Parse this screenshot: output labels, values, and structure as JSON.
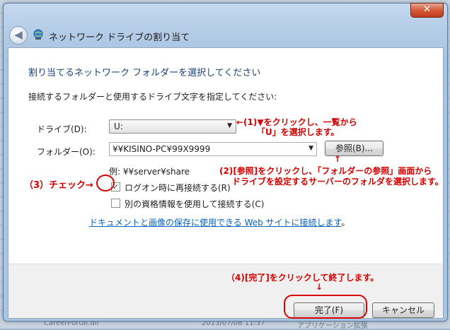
{
  "window": {
    "title": "ネットワーク ドライブの割り当て",
    "close_glyph": "✕"
  },
  "background_strip": {
    "items": [
      "CareerPortal.dll",
      "2013/07/08 11:37",
      "アプリケーション拡張"
    ]
  },
  "content": {
    "heading": "割り当てるネットワーク フォルダーを選択してください",
    "subtext": "接続するフォルダーと使用するドライブ文字を指定してください:",
    "drive_label": "ドライブ(D):",
    "drive_value": "U:",
    "folder_label": "フォルダー(O):",
    "folder_value": "¥¥KISINO-PC¥99X9999",
    "browse_label": "参照(B)...",
    "example": "例: ¥¥server¥share",
    "reconnect_label": "ログオン時に再接続する(R)",
    "reconnect_checked": true,
    "credentials_label": "別の資格情報を使用して接続する(C)",
    "credentials_checked": false,
    "link_text": "ドキュメントと画像の保存に使用できる Web サイトに接続します",
    "link_suffix": "。"
  },
  "footer": {
    "finish_label": "完了(F)",
    "cancel_label": "キャンセル"
  },
  "annotations": {
    "drive_note_line1": "←(1)▼をクリックし、一覧から",
    "drive_note_line2": "「U」を選択します。",
    "browse_note_arrow": "↑",
    "browse_note_line1": "(2)[参照]をクリックし、「フォルダーの参照」画面から",
    "browse_note_line2": "ドライブを設定するサーバーのフォルダを選択します。",
    "check_note": "（3）チェック→",
    "finish_note": "（4)[完了]をクリックして終了します。",
    "finish_arrow": "↓",
    "color": "#d40000"
  }
}
